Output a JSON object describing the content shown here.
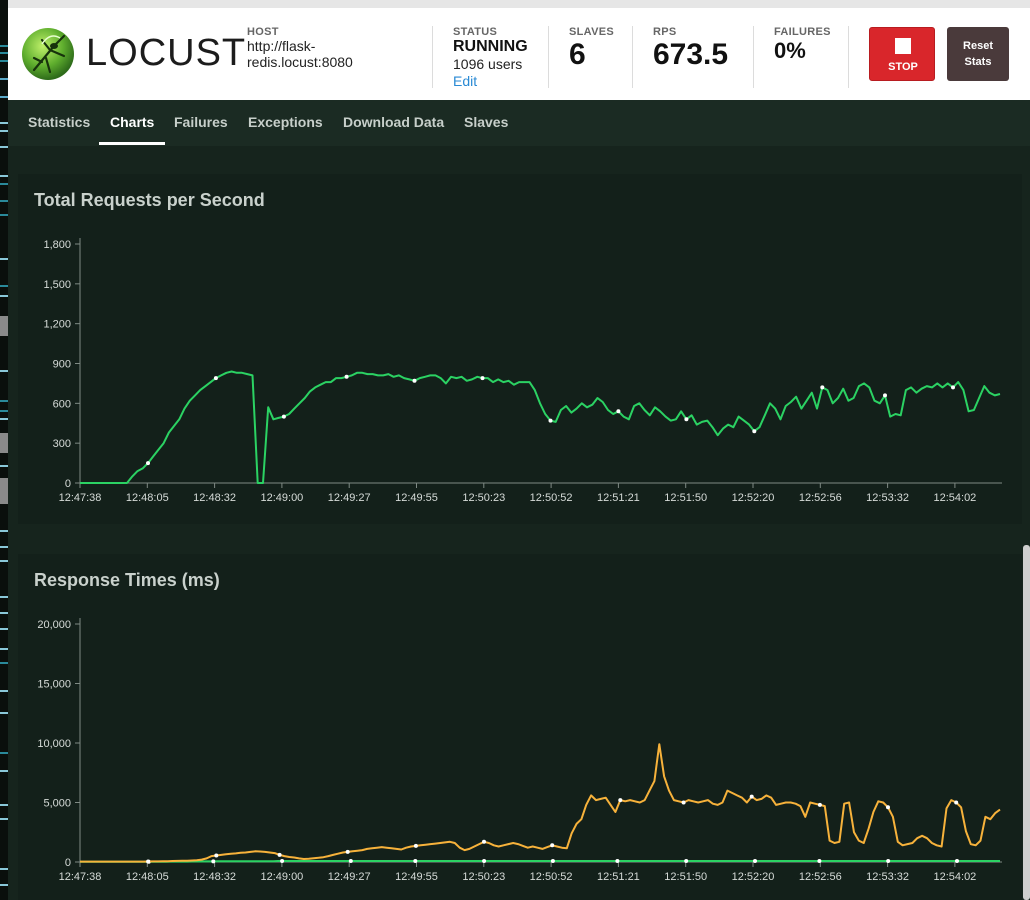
{
  "header": {
    "logo_text": "LOCUST",
    "host_label": "HOST",
    "host_value": "http://flask-redis.locust:8080",
    "status_label": "STATUS",
    "status_value": "RUNNING",
    "users_value": "1096 users",
    "edit_label": "Edit",
    "slaves_label": "SLAVES",
    "slaves_value": "6",
    "rps_label": "RPS",
    "rps_value": "673.5",
    "failures_label": "FAILURES",
    "failures_value": "0%",
    "stop_label": "STOP",
    "reset_label": "Reset\nStats"
  },
  "nav": {
    "tabs": [
      {
        "label": "Statistics",
        "active": false
      },
      {
        "label": "Charts",
        "active": true
      },
      {
        "label": "Failures",
        "active": false
      },
      {
        "label": "Exceptions",
        "active": false
      },
      {
        "label": "Download Data",
        "active": false
      },
      {
        "label": "Slaves",
        "active": false
      }
    ]
  },
  "colors": {
    "rps_line": "#2bd263",
    "median_line": "#2bd263",
    "p95_line": "#f7b23b",
    "stop_button": "#d9262b",
    "panel_bg": "#13201a"
  },
  "chart_data": [
    {
      "type": "line",
      "title": "Total Requests per Second",
      "x": [
        "12:47:38",
        "12:48:05",
        "12:48:32",
        "12:49:00",
        "12:49:27",
        "12:49:55",
        "12:50:23",
        "12:50:52",
        "12:51:21",
        "12:51:50",
        "12:52:20",
        "12:52:56",
        "12:53:32",
        "12:54:02"
      ],
      "ylim": [
        0,
        1800
      ],
      "yticks": [
        0,
        300,
        600,
        900,
        1200,
        1500,
        1800
      ],
      "series": [
        {
          "values": [
            0,
            0,
            0,
            0,
            0,
            0,
            0,
            0,
            0,
            0,
            50,
            90,
            110,
            150,
            200,
            250,
            300,
            380,
            430,
            480,
            560,
            620,
            660,
            700,
            730,
            760,
            790,
            810,
            830,
            840,
            830,
            830,
            820,
            810,
            0,
            0,
            570,
            480,
            490,
            500,
            520,
            560,
            600,
            640,
            690,
            720,
            740,
            760,
            760,
            790,
            790,
            800,
            810,
            830,
            830,
            820,
            820,
            810,
            810,
            820,
            800,
            810,
            790,
            780,
            770,
            790,
            800,
            810,
            810,
            790,
            750,
            800,
            790,
            800,
            770,
            780,
            800,
            790,
            790,
            760,
            780,
            760,
            770,
            740,
            760,
            760,
            760,
            700,
            600,
            520,
            470,
            460,
            550,
            580,
            530,
            560,
            600,
            570,
            590,
            640,
            610,
            550,
            520,
            540,
            500,
            480,
            580,
            600,
            550,
            510,
            570,
            540,
            500,
            470,
            480,
            540,
            480,
            510,
            440,
            460,
            470,
            420,
            360,
            410,
            440,
            420,
            500,
            470,
            440,
            390,
            420,
            510,
            600,
            560,
            480,
            580,
            610,
            650,
            560,
            620,
            680,
            560,
            720,
            700,
            600,
            640,
            710,
            620,
            640,
            730,
            750,
            720,
            620,
            600,
            660,
            500,
            520,
            510,
            700,
            720,
            680,
            710,
            730,
            720,
            750,
            720,
            750,
            720,
            760,
            700,
            540,
            550,
            640,
            730,
            680,
            660,
            670
          ]
        }
      ]
    },
    {
      "type": "line",
      "title": "Response Times (ms)",
      "x": [
        "12:47:38",
        "12:48:05",
        "12:48:32",
        "12:49:00",
        "12:49:27",
        "12:49:55",
        "12:50:23",
        "12:50:52",
        "12:51:21",
        "12:51:50",
        "12:52:20",
        "12:52:56",
        "12:53:32",
        "12:54:02"
      ],
      "ylim": [
        0,
        20000
      ],
      "yticks": [
        0,
        5000,
        10000,
        15000,
        20000
      ],
      "series": [
        {
          "values": [
            30,
            30,
            30,
            30,
            30,
            30,
            30,
            30,
            30,
            30,
            30,
            30,
            30,
            30,
            40,
            50,
            50,
            60,
            70,
            80,
            90,
            100,
            110,
            130,
            150,
            200,
            300,
            500,
            550,
            600,
            650,
            700,
            720,
            780,
            800,
            850,
            900,
            880,
            850,
            800,
            750,
            600,
            500,
            420,
            380,
            300,
            250,
            280,
            320,
            350,
            400,
            500,
            600,
            700,
            800,
            850,
            900,
            950,
            1000,
            1100,
            1150,
            1200,
            1250,
            1200,
            1150,
            1100,
            1050,
            1200,
            1300,
            1350,
            1400,
            1450,
            1500,
            1550,
            1600,
            1650,
            1700,
            1600,
            1200,
            1000,
            1100,
            1300,
            1500,
            1700,
            1600,
            1400,
            1300,
            1400,
            1500,
            1600,
            1500,
            1350,
            1200,
            1300,
            1200,
            1100,
            1250,
            1400,
            1300,
            1200,
            1150,
            2400,
            3200,
            3600,
            4800,
            5600,
            5200,
            5300,
            5400,
            4800,
            4200,
            5200,
            5100,
            5200,
            5100,
            5000,
            5200,
            6000,
            6800,
            9900,
            7200,
            6000,
            5200,
            5100,
            5000,
            5200,
            5100,
            5000,
            5100,
            5200,
            4900,
            4800,
            5000,
            6000,
            5800,
            5600,
            5400,
            5000,
            5500,
            5200,
            5300,
            5600,
            5400,
            4800,
            4900,
            5000,
            5000,
            4900,
            4700,
            3800,
            5000,
            4900,
            4800,
            4700,
            1800,
            1600,
            1700,
            4900,
            5000,
            2500,
            1800,
            1600,
            2800,
            4200,
            5100,
            5000,
            4600,
            3800,
            1700,
            1400,
            1500,
            1600,
            2000,
            2200,
            2000,
            1600,
            1400,
            1300,
            4500,
            5200,
            5000,
            4600,
            2600,
            1500,
            1400,
            1800,
            3800,
            3600,
            4100,
            4400
          ]
        },
        {
          "values": [
            20,
            20,
            20,
            20,
            20,
            20,
            20,
            20,
            20,
            20,
            20,
            20,
            20,
            20,
            20,
            20,
            20,
            20,
            20,
            20,
            20,
            30,
            30,
            30,
            30,
            30,
            40,
            40,
            40,
            50,
            50,
            50,
            60,
            60,
            60,
            60,
            60,
            70,
            70,
            70,
            70,
            70,
            70,
            70,
            70,
            70,
            80,
            80,
            80,
            80,
            80,
            80,
            80,
            80,
            80,
            80,
            80,
            80,
            80,
            80,
            80,
            80,
            80,
            80,
            80,
            80,
            80,
            80,
            80,
            80,
            80,
            80,
            80,
            80,
            80,
            80,
            80,
            80,
            80,
            80,
            80,
            80,
            80,
            80,
            80,
            80,
            80,
            80,
            80,
            80,
            80,
            80,
            80,
            80,
            80,
            80,
            80,
            80,
            80,
            80,
            80,
            80,
            80,
            80,
            80,
            80,
            80,
            80,
            80,
            80,
            80,
            80,
            80,
            80,
            80,
            80,
            80,
            80,
            80,
            80,
            80,
            80,
            80,
            80,
            80,
            80,
            80,
            80,
            80,
            80,
            80,
            80,
            80,
            80,
            80,
            80,
            80,
            80,
            80,
            80,
            80,
            80,
            80,
            80,
            80,
            80,
            80,
            80,
            80,
            80,
            80,
            80,
            80,
            80,
            80,
            80,
            80,
            80,
            80,
            80,
            80,
            80,
            80,
            80,
            80,
            80,
            80,
            80,
            80,
            80,
            80,
            80,
            80,
            80,
            80,
            80,
            80,
            80,
            80,
            80,
            80,
            80,
            80,
            80,
            80,
            80,
            80,
            80,
            80,
            80,
            80,
            80,
            80,
            80,
            80,
            80,
            80,
            80,
            80,
            80,
            80,
            80,
            80,
            80,
            80,
            80,
            80,
            80,
            80,
            80,
            80,
            80,
            80,
            80,
            80
          ]
        }
      ]
    }
  ]
}
